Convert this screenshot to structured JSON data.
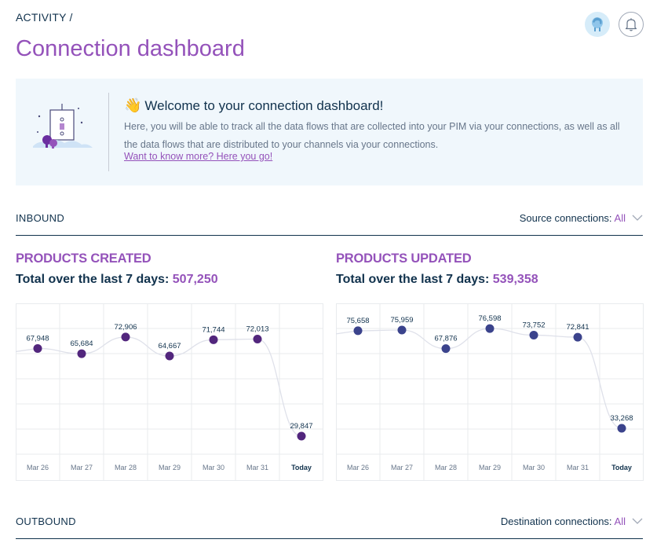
{
  "header": {
    "breadcrumb": "ACTIVITY /",
    "title": "Connection dashboard"
  },
  "welcome": {
    "emoji": "👋",
    "title": "Welcome to your connection dashboard!",
    "text": "Here, you will be able to track all the data flows that are collected into your PIM via your connections, as well as all the data flows that are distributed to your channels via your connections.",
    "link": "Want to know more? Here you go!"
  },
  "inbound": {
    "title": "INBOUND",
    "filter_label": "Source connections:",
    "filter_value": "All"
  },
  "outbound": {
    "title": "OUTBOUND",
    "filter_label": "Destination connections:",
    "filter_value": "All"
  },
  "products_created": {
    "title": "PRODUCTS CREATED",
    "total_label": "Total over the last 7 days:",
    "total_value": "507,250"
  },
  "products_updated": {
    "title": "PRODUCTS UPDATED",
    "total_label": "Total over the last 7 days:",
    "total_value": "539,358"
  },
  "colors": {
    "accent": "#9452ba",
    "text": "#11324d",
    "created_point": "#52267d",
    "updated_point": "#3b438c",
    "grid": "#e8ebee",
    "welcome_bg": "#f0f7fc"
  },
  "chart_data": [
    {
      "type": "line",
      "categories": [
        "Mar 26",
        "Mar 27",
        "Mar 28",
        "Mar 29",
        "Mar 30",
        "Mar 31",
        "Today"
      ],
      "values": [
        67948,
        65684,
        72906,
        64667,
        71744,
        72013,
        29847
      ],
      "labels": [
        "67,948",
        "65,684",
        "72,906",
        "64,667",
        "71,744",
        "72,013",
        "29,847"
      ],
      "title": "PRODUCTS CREATED",
      "grid": true
    },
    {
      "type": "line",
      "categories": [
        "Mar 26",
        "Mar 27",
        "Mar 28",
        "Mar 29",
        "Mar 30",
        "Mar 31",
        "Today"
      ],
      "values": [
        75658,
        75959,
        67876,
        76598,
        73752,
        72841,
        33268
      ],
      "labels": [
        "75,658",
        "75,959",
        "67,876",
        "76,598",
        "73,752",
        "72,841",
        "33,268"
      ],
      "title": "PRODUCTS UPDATED",
      "grid": true
    }
  ]
}
